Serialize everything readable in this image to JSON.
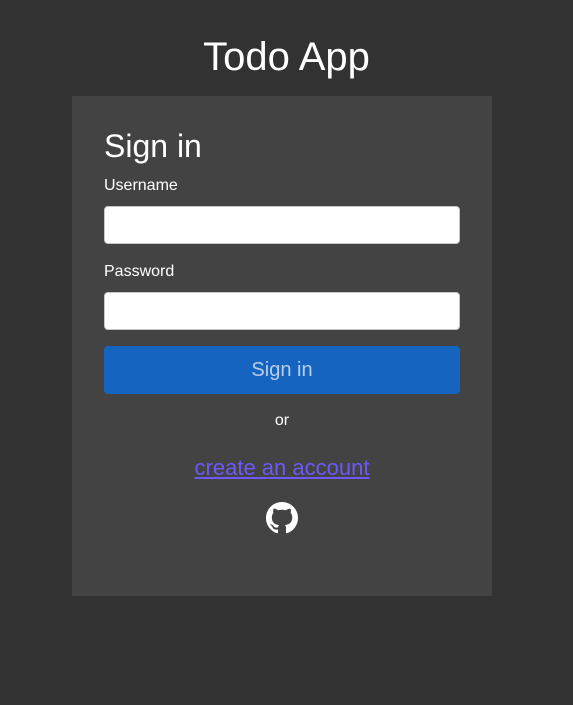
{
  "app": {
    "title": "Todo App"
  },
  "form": {
    "heading": "Sign in",
    "username_label": "Username",
    "username_value": "",
    "password_label": "Password",
    "password_value": "",
    "submit_label": "Sign in",
    "divider_text": "or",
    "create_account_link": "create an account",
    "github_icon": "github-icon"
  },
  "colors": {
    "page_background": "#323232",
    "card_background": "#434343",
    "primary_button": "#1565c0",
    "link": "#6a5af9"
  }
}
